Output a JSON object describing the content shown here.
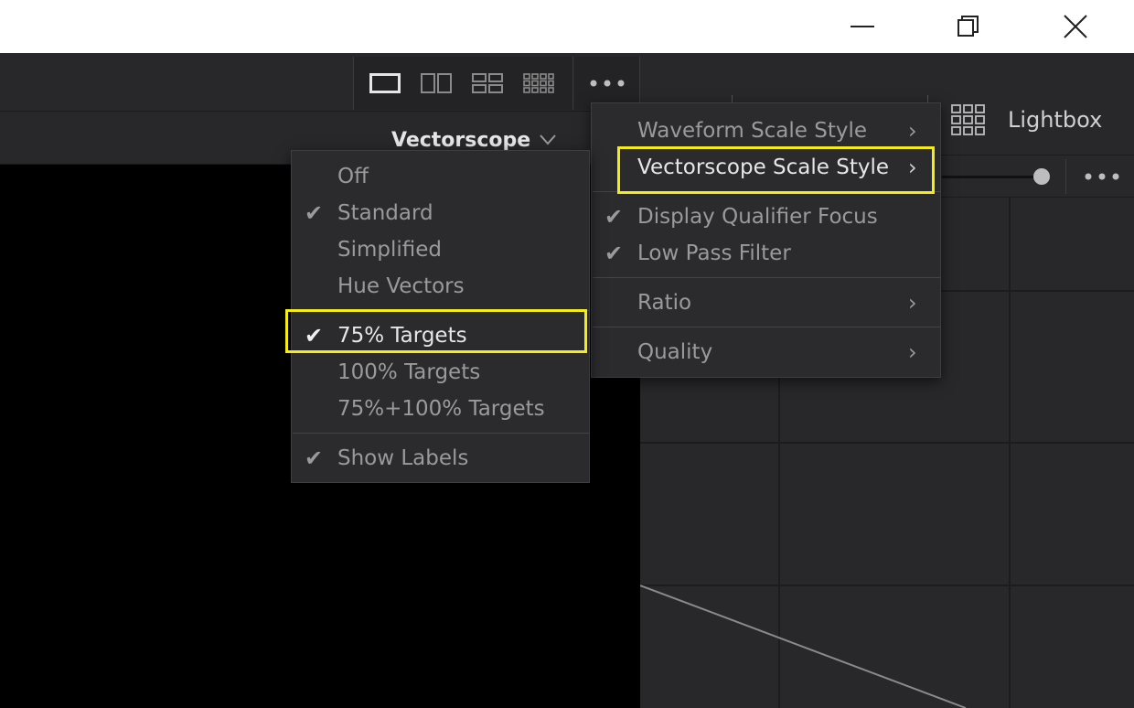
{
  "scope_selector": {
    "label": "Vectorscope"
  },
  "right_panel": {
    "lightbox_label": "Lightbox"
  },
  "options_menu": {
    "items": [
      {
        "label": "Waveform Scale Style",
        "submenu": true
      },
      {
        "label": "Vectorscope Scale Style",
        "submenu": true,
        "active": true
      },
      {
        "label": "Display Qualifier Focus",
        "checked": true
      },
      {
        "label": "Low Pass Filter",
        "checked": true
      },
      {
        "label": "Ratio",
        "submenu": true
      },
      {
        "label": "Quality",
        "submenu": true
      }
    ]
  },
  "scale_style_menu": {
    "items": [
      {
        "label": "Off",
        "checked": false
      },
      {
        "label": "Standard",
        "checked": true
      },
      {
        "label": "Simplified",
        "checked": false
      },
      {
        "label": "Hue Vectors",
        "checked": false
      },
      {
        "label": "75% Targets",
        "checked": true,
        "highlighted": true
      },
      {
        "label": "100% Targets",
        "checked": false
      },
      {
        "label": "75%+100% Targets",
        "checked": false
      },
      {
        "label": "Show Labels",
        "checked": true
      }
    ]
  },
  "icons": {
    "minimize": "minimize-icon",
    "maximize": "restore-icon",
    "close": "close-icon",
    "layout_single": "layout-single-icon",
    "layout_dual": "layout-dual-icon",
    "layout_quad": "layout-quad-icon",
    "layout_grid": "layout-grid-icon",
    "more": "more-icon",
    "chevron": "chevron-down-icon",
    "lightbox": "lightbox-grid-icon"
  },
  "colors": {
    "highlight": "#f5ea1a",
    "panel": "#28282a",
    "menu": "#2b2b2d",
    "text_dim": "#9a9a9a",
    "text_bright": "#e6e6e6"
  }
}
